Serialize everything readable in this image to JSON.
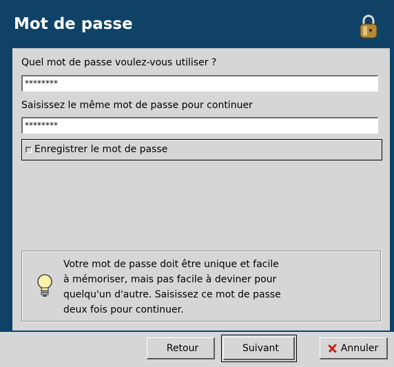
{
  "window": {
    "title": "Mot de passe"
  },
  "form": {
    "question_label": "Quel mot de passe voulez-vous utiliser ?",
    "password_value": "********",
    "confirm_label": "Saisissez le même mot de passe pour continuer",
    "confirm_value": "********",
    "remember_label": "Enregistrer le mot de passe",
    "remember_checked": false
  },
  "hint": {
    "text": "Votre mot de passe doit être unique et facile\nà mémoriser, mais pas facile à deviner pour\nquelqu'un d'autre. Saisissez ce mot de passe\ndeux fois pour continuer."
  },
  "buttons": {
    "back_label": "Retour",
    "next_label": "Suivant",
    "cancel_label": "Annuler"
  },
  "colors": {
    "header_bg": "#0f4266",
    "panel_bg": "#d6d6d6",
    "arrow_green": "#3a7a3a",
    "cancel_red": "#c8201a"
  },
  "icons": [
    "lock-icon",
    "lightbulb-icon",
    "left-arrow-icon",
    "right-arrow-icon",
    "cancel-x-icon"
  ]
}
